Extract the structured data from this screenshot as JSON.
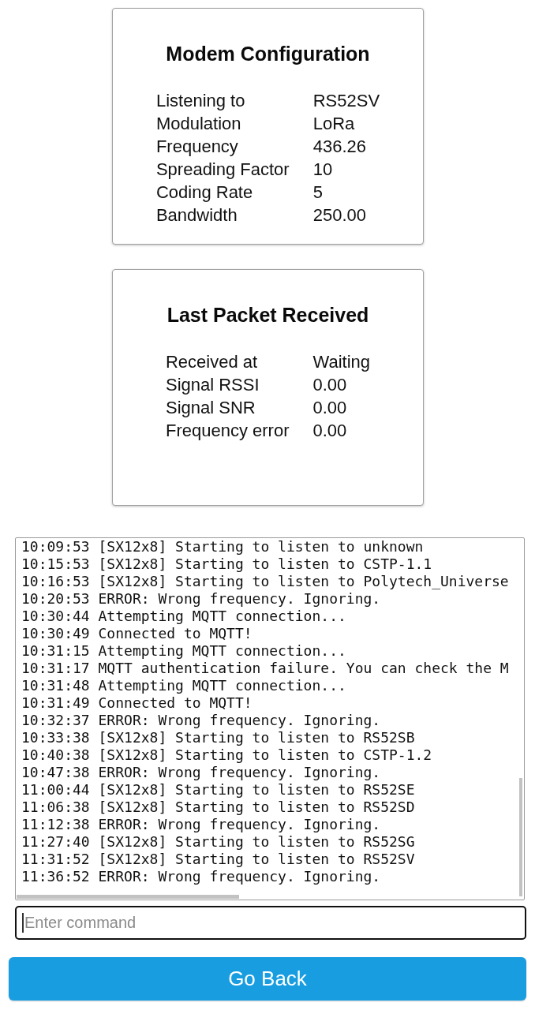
{
  "cards": [
    {
      "title": "Modem Configuration",
      "rows": [
        {
          "label": "Listening to",
          "value": "RS52SV"
        },
        {
          "label": "Modulation",
          "value": "LoRa"
        },
        {
          "label": "Frequency",
          "value": "436.26"
        },
        {
          "label": "Spreading Factor",
          "value": "10"
        },
        {
          "label": "Coding Rate",
          "value": "5"
        },
        {
          "label": "Bandwidth",
          "value": "250.00"
        }
      ]
    },
    {
      "title": "Last Packet Received",
      "rows": [
        {
          "label": "Received at",
          "value": "Waiting"
        },
        {
          "label": "Signal RSSI",
          "value": "0.00"
        },
        {
          "label": "Signal SNR",
          "value": "0.00"
        },
        {
          "label": "Frequency error",
          "value": "0.00"
        }
      ]
    }
  ],
  "log": {
    "lines": [
      "10:09:53 [SX12x8] Starting to listen to unknown",
      "10:15:53 [SX12x8] Starting to listen to CSTP-1.1",
      "10:16:53 [SX12x8] Starting to listen to Polytech_Universe",
      "10:20:53 ERROR: Wrong frequency. Ignoring.",
      "10:30:44 Attempting MQTT connection...",
      "10:30:49 Connected to MQTT!",
      "10:31:15 Attempting MQTT connection...",
      "10:31:17 MQTT authentication failure. You can check the M",
      "10:31:48 Attempting MQTT connection...",
      "10:31:49 Connected to MQTT!",
      "10:32:37 ERROR: Wrong frequency. Ignoring.",
      "10:33:38 [SX12x8] Starting to listen to RS52SB",
      "10:40:38 [SX12x8] Starting to listen to CSTP-1.2",
      "10:47:38 ERROR: Wrong frequency. Ignoring.",
      "11:00:44 [SX12x8] Starting to listen to RS52SE",
      "11:06:38 [SX12x8] Starting to listen to RS52SD",
      "11:12:38 ERROR: Wrong frequency. Ignoring.",
      "11:27:40 [SX12x8] Starting to listen to RS52SG",
      "11:31:52 [SX12x8] Starting to listen to RS52SV",
      "11:36:52 ERROR: Wrong frequency. Ignoring."
    ]
  },
  "command_input": {
    "placeholder": "Enter command"
  },
  "back_button": {
    "label": "Go Back"
  }
}
